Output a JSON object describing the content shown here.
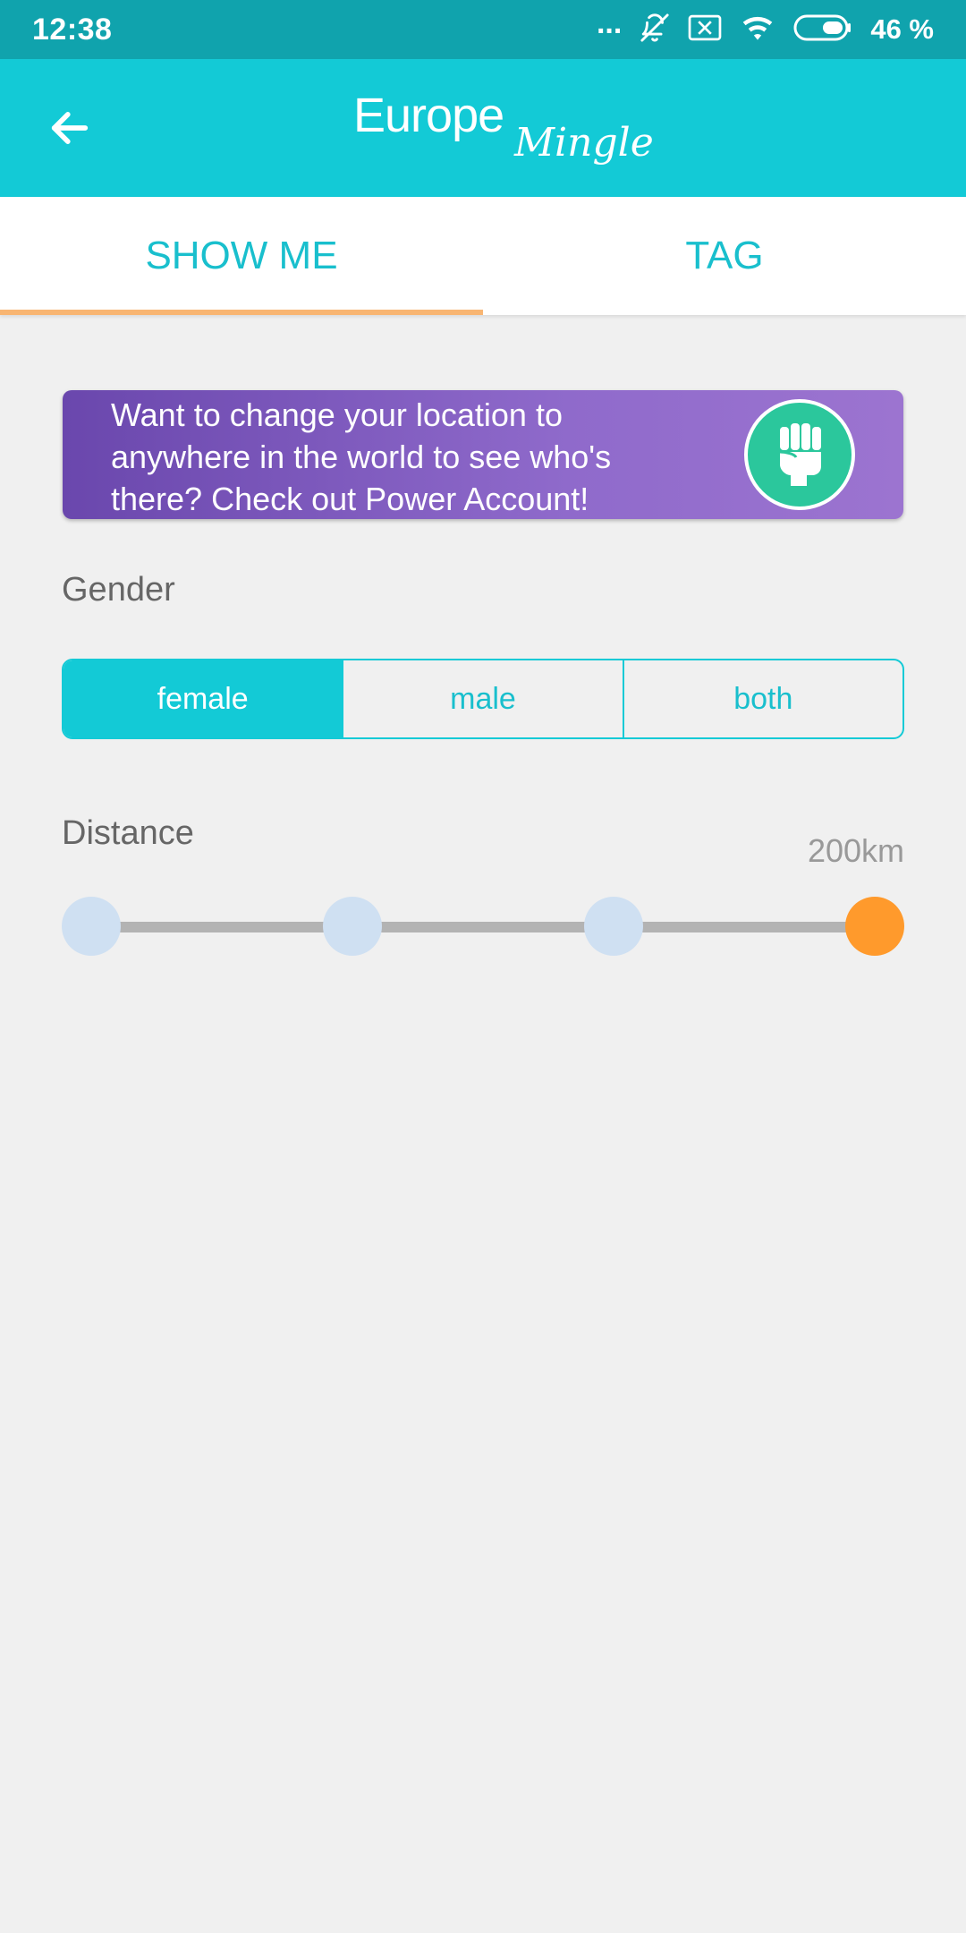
{
  "status_bar": {
    "time": "12:38",
    "dots": "...",
    "battery_text": "46 %",
    "icons": [
      "bell-off-icon",
      "x-box-icon",
      "wifi-icon",
      "battery-icon"
    ]
  },
  "app_bar": {
    "logo_europe": "Europe",
    "logo_mingle": "Mingle",
    "back_icon": "arrow-left-icon"
  },
  "tabs": [
    {
      "label": "SHOW ME",
      "active": true
    },
    {
      "label": "TAG",
      "active": false
    }
  ],
  "promo": {
    "text": "Want to change your location to anywhere in the world to see who's there? Check out Power Account!",
    "icon": "fist-icon"
  },
  "gender": {
    "label": "Gender",
    "options": [
      "female",
      "male",
      "both"
    ],
    "selected": "female"
  },
  "distance": {
    "label": "Distance",
    "value": "200km",
    "stops": 4,
    "selected_stop": 4
  },
  "colors": {
    "status_bar": "#10a3ad",
    "app_bar": "#13cad6",
    "accent_text": "#19bfcd",
    "tab_indicator": "#f8b572",
    "promo_start": "#6a47ad",
    "promo_end": "#9c74d0",
    "promo_badge": "#2bc79c",
    "slider_selected": "#ff9a2c",
    "slider_stop": "#cfe0f2",
    "background": "#f0f0f0"
  }
}
